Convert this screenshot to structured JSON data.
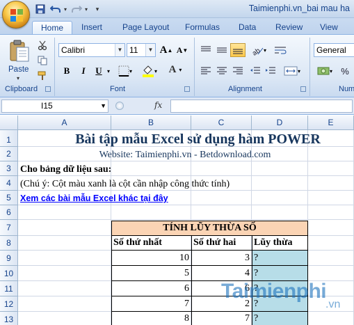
{
  "window": {
    "title": "Taimienphi.vn_bai mau ha"
  },
  "tabs": [
    "Home",
    "Insert",
    "Page Layout",
    "Formulas",
    "Data",
    "Review",
    "View"
  ],
  "ribbon": {
    "paste_label": "Paste",
    "font_name": "Calibri",
    "font_size": "11",
    "number_format": "General",
    "groups": {
      "clipboard": "Clipboard",
      "font": "Font",
      "alignment": "Alignment",
      "number": "Num"
    },
    "bold": "B",
    "italic": "I",
    "underline": "U",
    "font_color_letter": "A",
    "grow_font": "A",
    "shrink_font": "A"
  },
  "formula_bar": {
    "name_box": "I15",
    "fx": "fx",
    "formula": ""
  },
  "columns": [
    "A",
    "B",
    "C",
    "D",
    "E"
  ],
  "rows": [
    "1",
    "2",
    "3",
    "4",
    "5",
    "6",
    "7",
    "8",
    "9",
    "10",
    "11",
    "12",
    "13"
  ],
  "sheet": {
    "title": "Bài tập mẫu Excel sử dụng hàm POWER",
    "website": "Website: Taimienphi.vn - Betdownload.com",
    "instruction": "Cho bảng dữ liệu sau:",
    "note": "(Chú ý: Cột màu xanh là cột cần nhập công thức tính)",
    "link": "Xem các bài mẫu Excel khác tại đây",
    "table": {
      "title": "TÍNH LŨY THỪA SỐ",
      "headers": [
        "Số thứ nhất",
        "Số thứ hai",
        "Lũy thừa"
      ],
      "rows": [
        [
          "10",
          "3",
          "?"
        ],
        [
          "5",
          "4",
          "?"
        ],
        [
          "6",
          "6",
          "?"
        ],
        [
          "7",
          "2",
          "?"
        ],
        [
          "8",
          "7",
          "?"
        ]
      ]
    }
  },
  "watermark": {
    "main": "Taimienphi",
    "suffix": ".vn"
  },
  "colors": {
    "table_title_bg": "#fbd4b4",
    "result_bg": "#b7dde8",
    "title_color": "#17365d",
    "link_color": "#0000ff",
    "watermark_color": "#1e73be"
  }
}
